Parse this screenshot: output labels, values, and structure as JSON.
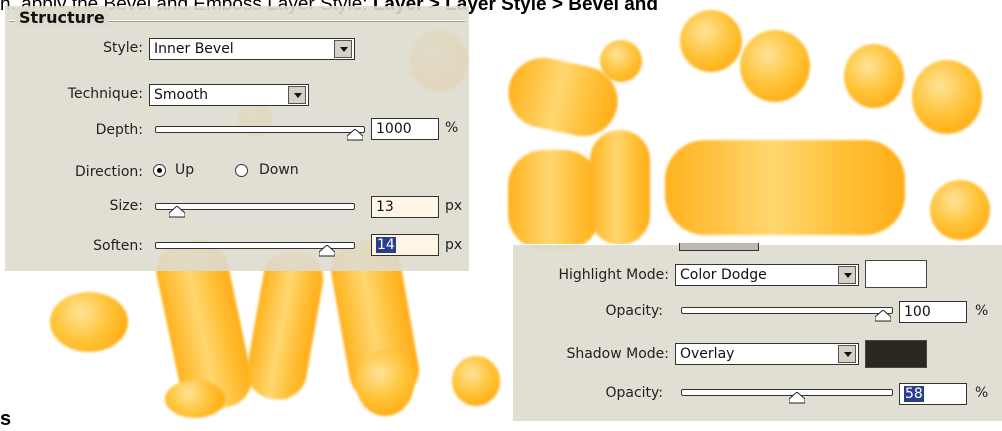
{
  "background": {
    "header_text_plain": "n. apply the Bevel and Emboss Layer Style: ",
    "header_text_bold": "Layer > Layer Style > Bevel and",
    "corner_letter": "s"
  },
  "structure_panel": {
    "title": "Structure",
    "style": {
      "label": "Style:",
      "value": "Inner Bevel"
    },
    "technique": {
      "label": "Technique:",
      "value": "Smooth"
    },
    "depth": {
      "label": "Depth:",
      "value": "1000",
      "unit": "%",
      "level": 1.0
    },
    "direction": {
      "label": "Direction:",
      "options": [
        "Up",
        "Down"
      ],
      "selected": "Up"
    },
    "size": {
      "label": "Size:",
      "value": "13",
      "unit": "px",
      "level": 0.1
    },
    "soften": {
      "label": "Soften:",
      "value": "14",
      "unit": "px",
      "level": 0.85
    }
  },
  "shading_panel": {
    "highlight_mode": {
      "label": "Highlight Mode:",
      "value": "Color Dodge",
      "swatch_color": "#ffffff"
    },
    "highlight_opacity": {
      "label": "Opacity:",
      "value": "100",
      "unit": "%",
      "level": 1.0
    },
    "shadow_mode": {
      "label": "Shadow Mode:",
      "value": "Overlay",
      "swatch_color": "#2a2620"
    },
    "shadow_opacity": {
      "label": "Opacity:",
      "value": "58",
      "unit": "%",
      "level": 0.58
    }
  },
  "colors": {
    "panel_bg": "#dedace",
    "highlight_selection": "#2b3e8c",
    "glow_orange": "#ffb21d"
  }
}
